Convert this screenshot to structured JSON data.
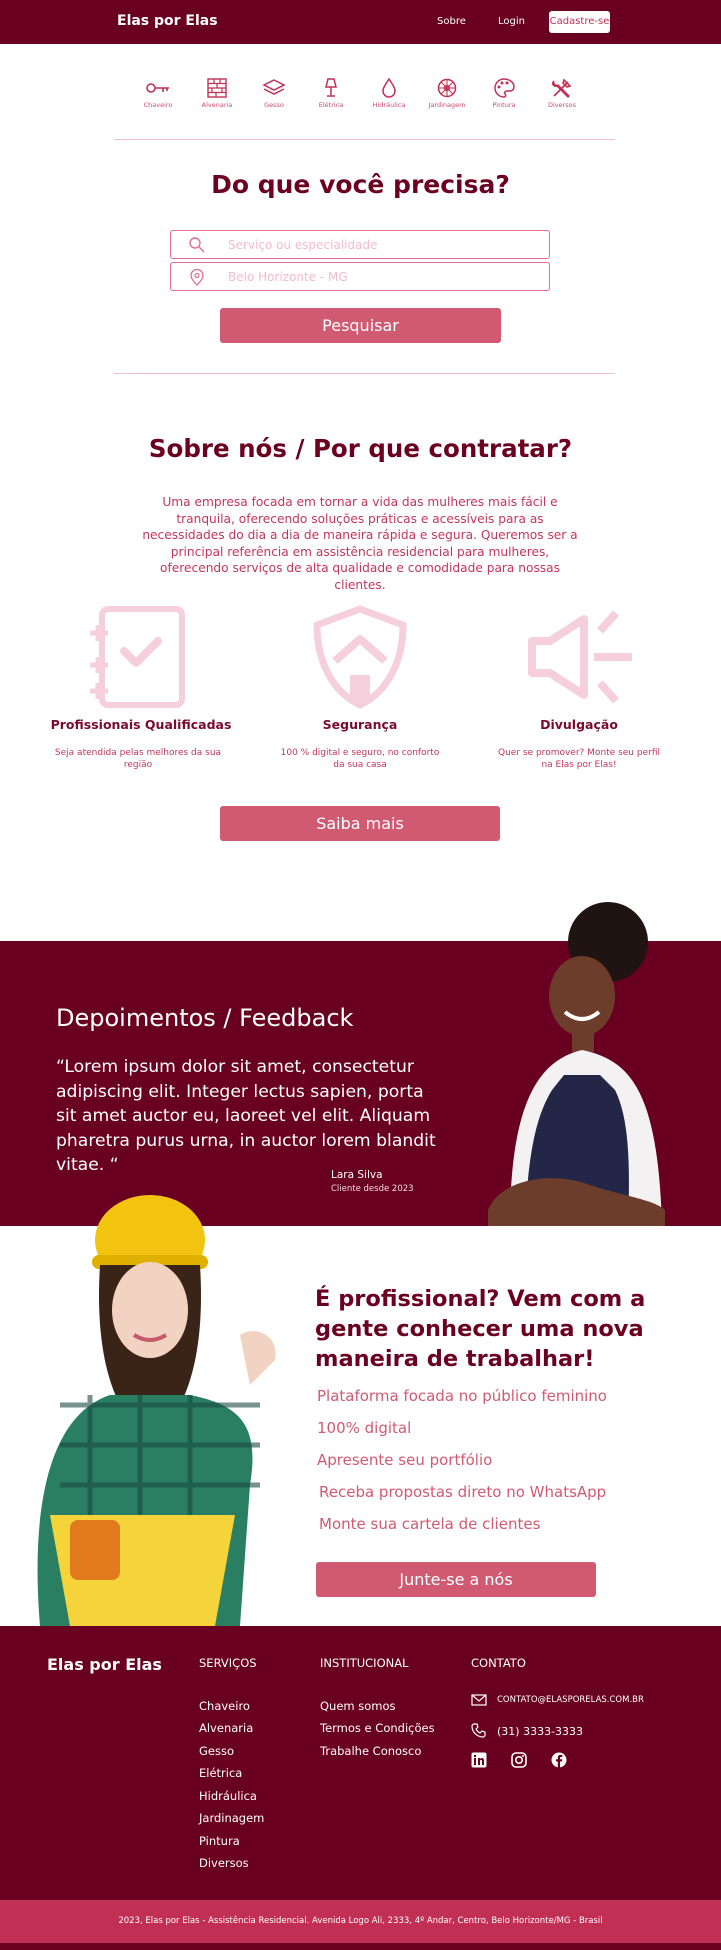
{
  "header": {
    "brand": "Elas por Elas",
    "nav": {
      "sobre": "Sobre",
      "login": "Login",
      "cadastre": "Cadastre-se"
    }
  },
  "categories": [
    {
      "label": "Chaveiro",
      "icon": "key-icon"
    },
    {
      "label": "Alvenaria",
      "icon": "brick-wall-icon"
    },
    {
      "label": "Gesso",
      "icon": "layers-icon"
    },
    {
      "label": "Elétrica",
      "icon": "lamp-icon"
    },
    {
      "label": "Hidráulica",
      "icon": "water-drop-icon"
    },
    {
      "label": "Jardinagem",
      "icon": "flower-icon"
    },
    {
      "label": "Pintura",
      "icon": "palette-icon"
    },
    {
      "label": "Diversos",
      "icon": "tools-icon"
    }
  ],
  "search": {
    "title": "Do que você precisa?",
    "service_placeholder": "Serviço ou especialidade",
    "location_placeholder": "Belo Horizonte - MG",
    "button": "Pesquisar"
  },
  "about": {
    "title": "Sobre nós / Por que contratar?",
    "text": "Uma empresa focada em tornar a vida das mulheres mais fácil e tranquila, oferecendo soluções práticas e acessíveis para as necessidades do dia a dia de maneira rápida e segura. Queremos ser a principal referência em assistência residencial para mulheres, oferecendo serviços de alta qualidade e comodidade para nossas clientes.",
    "features": [
      {
        "title": "Profissionais Qualificadas",
        "desc": "Seja atendida pelas melhores da sua região",
        "icon": "checklist-icon"
      },
      {
        "title": "Segurança",
        "desc": "100 % digital e seguro, no conforto da sua casa",
        "icon": "shield-home-icon"
      },
      {
        "title": "Divulgação",
        "desc": "Quer se promover? Monte seu perfil na Elas por Elas!",
        "icon": "megaphone-icon"
      }
    ],
    "button": "Saiba mais"
  },
  "testimonial": {
    "title": "Depoimentos / Feedback",
    "quote": "“Lorem ipsum dolor sit amet, consectetur adipiscing elit. Integer lectus sapien, porta sit amet auctor eu, laoreet vel elit. Aliquam pharetra purus urna, in auctor lorem blandit vitae. “",
    "name": "Lara Silva",
    "since": "Cliente desde 2023"
  },
  "professional": {
    "title": "É profissional? Vem com a gente conhecer uma nova maneira de trabalhar!",
    "items": [
      "Plataforma focada no público feminino",
      "100% digital",
      "Apresente seu portfólio",
      "Receba propostas direto no WhatsApp",
      "Monte sua cartela de clientes"
    ],
    "button": "Junte-se a nós"
  },
  "footer": {
    "brand": "Elas por Elas",
    "services_head": "SERVIÇOS",
    "services": [
      "Chaveiro",
      "Alvenaria",
      "Gesso",
      "Elétrica",
      "Hidráulica",
      "Jardinagem",
      "Pintura",
      "Diversos"
    ],
    "inst_head": "INSTITUCIONAL",
    "inst": [
      "Quem somos",
      "Termos e Condições",
      "Trabalhe Conosco"
    ],
    "contact_head": "CONTATO",
    "email": "CONTATO@ELASPORELAS.COM.BR",
    "phone": "(31) 3333-3333",
    "social": [
      "linkedin-icon",
      "instagram-icon",
      "facebook-icon"
    ],
    "copyright": "2023, Elas por Elas - Assistência Residencial. Avenida Logo Ali, 2333, 4º Andar, Centro, Belo Horizonte/MG - Brasil"
  },
  "colors": {
    "brand": "#6a0021",
    "accent": "#d15a73",
    "pink": "#c12f55",
    "light": "#f2c0cf"
  }
}
